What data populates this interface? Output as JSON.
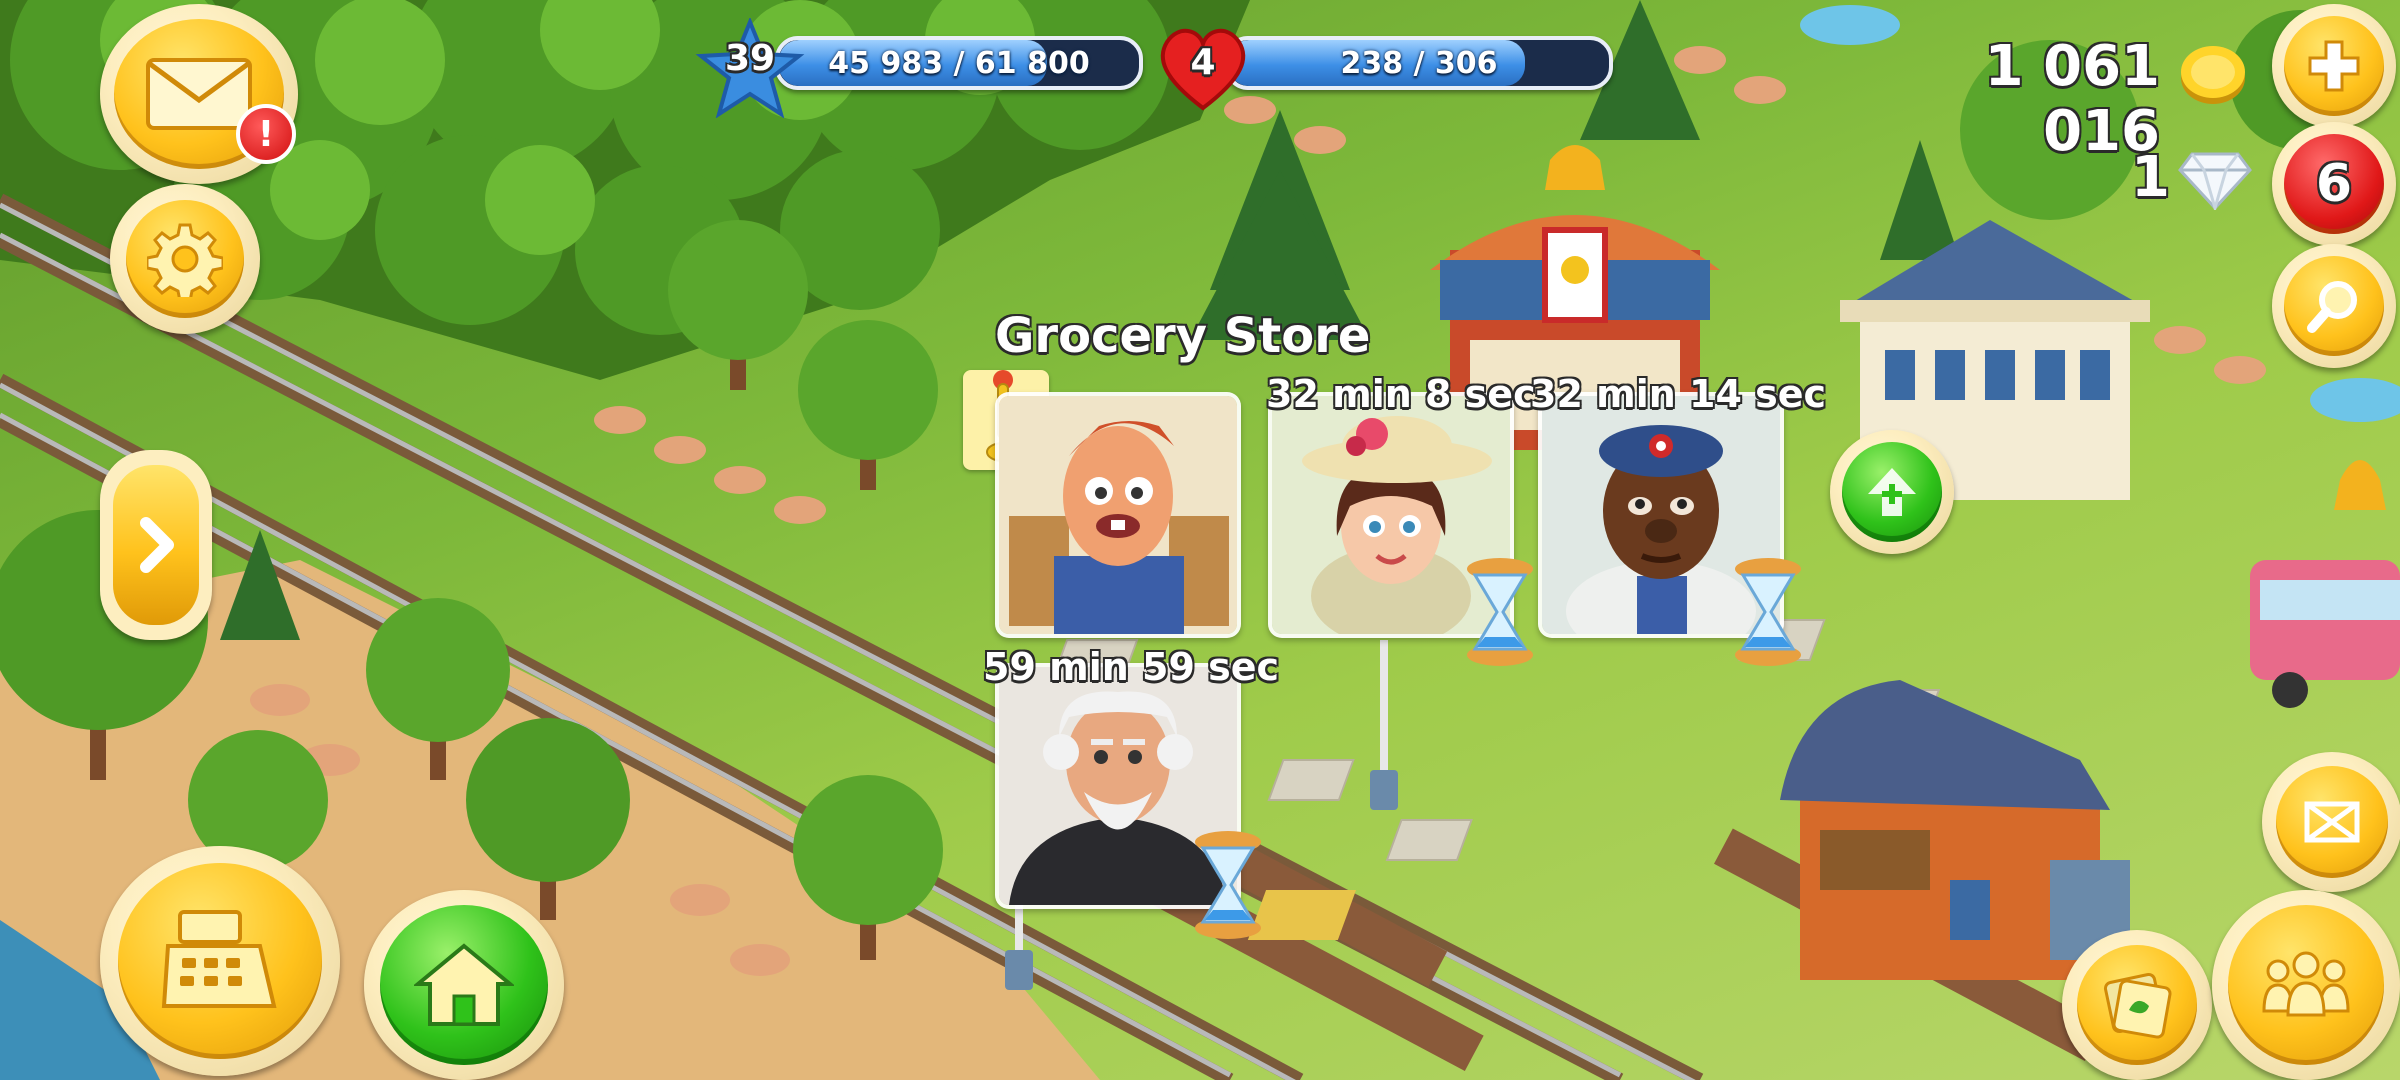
{
  "hud": {
    "level": "39",
    "xp_text": "45 983 / 61 800",
    "xp_progress": 0.744,
    "hearts_level": "4",
    "reputation_text": "238 / 306",
    "reputation_progress": 0.778,
    "coins": "1 061 016",
    "diamonds": "1",
    "notification_count": "6",
    "mail_alert": "!"
  },
  "store": {
    "title": "Grocery Store",
    "visitors": [
      {
        "character": "red-haired-farmer",
        "timer": ""
      },
      {
        "character": "lady-with-hat",
        "timer": "32 min 8 sec"
      },
      {
        "character": "man-with-cap",
        "timer": "32 min 14 sec"
      },
      {
        "character": "old-bearded-man",
        "timer": "59 min 59 sec"
      }
    ]
  },
  "icons": {
    "mail": "envelope-icon",
    "settings": "gear-icon",
    "expand": "chevron-right-icon",
    "cash_register": "cash-register-icon",
    "home": "house-icon",
    "add": "plus-icon",
    "search": "magnifier-icon",
    "fullscreen": "fullscreen-icon",
    "friends": "friends-icon",
    "decorate": "decorate-icon",
    "upgrade": "green-arrow-icon"
  },
  "colors": {
    "button_gold": "#ffc21c",
    "button_green": "#2fc21a",
    "badge_red": "#e01818",
    "bar_blue": "#3d8fe6"
  }
}
